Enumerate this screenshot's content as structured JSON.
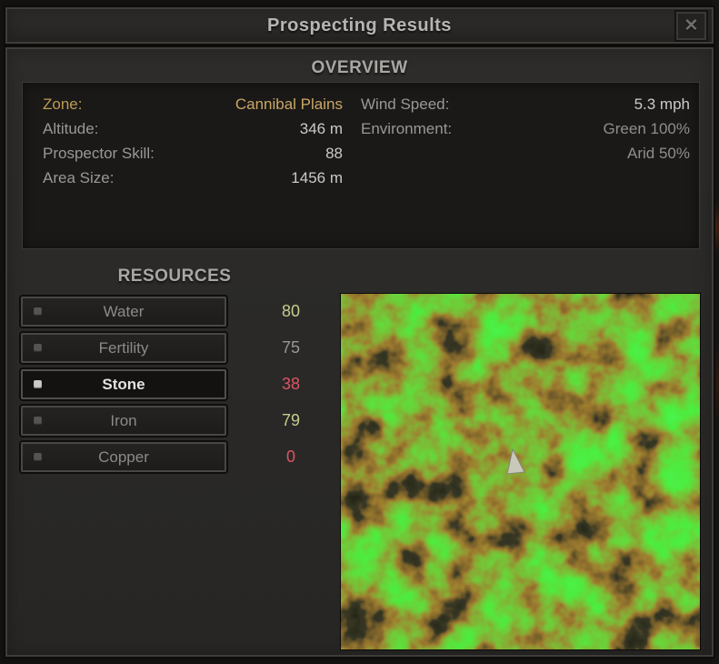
{
  "window": {
    "title": "Prospecting Results",
    "close_icon": "✕"
  },
  "overview": {
    "header": "OVERVIEW",
    "left_rows": [
      {
        "label": "Zone:",
        "value": "Cannibal Plains",
        "gold": true
      },
      {
        "label": "Altitude:",
        "value": "346 m"
      },
      {
        "label": "Prospector Skill:",
        "value": "88"
      },
      {
        "label": "Area Size:",
        "value": "1456 m"
      }
    ],
    "right_rows": [
      {
        "label": "Wind Speed:",
        "value": "5.3 mph",
        "dim": false
      },
      {
        "label": "Environment:",
        "value": "Green 100%",
        "dim": true
      },
      {
        "label": "",
        "value": "Arid 50%",
        "dim": true
      }
    ]
  },
  "resources": {
    "header": "RESOURCES",
    "items": [
      {
        "label": "Water",
        "value": "80",
        "value_color": "#c6cb8e",
        "selected": false
      },
      {
        "label": "Fertility",
        "value": "75",
        "value_color": "#969694",
        "selected": false
      },
      {
        "label": "Stone",
        "value": "38",
        "value_color": "#de5365",
        "selected": true
      },
      {
        "label": "Iron",
        "value": "79",
        "value_color": "#c6cb8e",
        "selected": false
      },
      {
        "label": "Copper",
        "value": "0",
        "value_color": "#de5365",
        "selected": false
      }
    ]
  },
  "map": {
    "terrain_colors": {
      "high": "#1ed21e",
      "mid": "#5a3c14",
      "low": "#0a0a05"
    },
    "cursor_color": "#c9c9bb"
  }
}
